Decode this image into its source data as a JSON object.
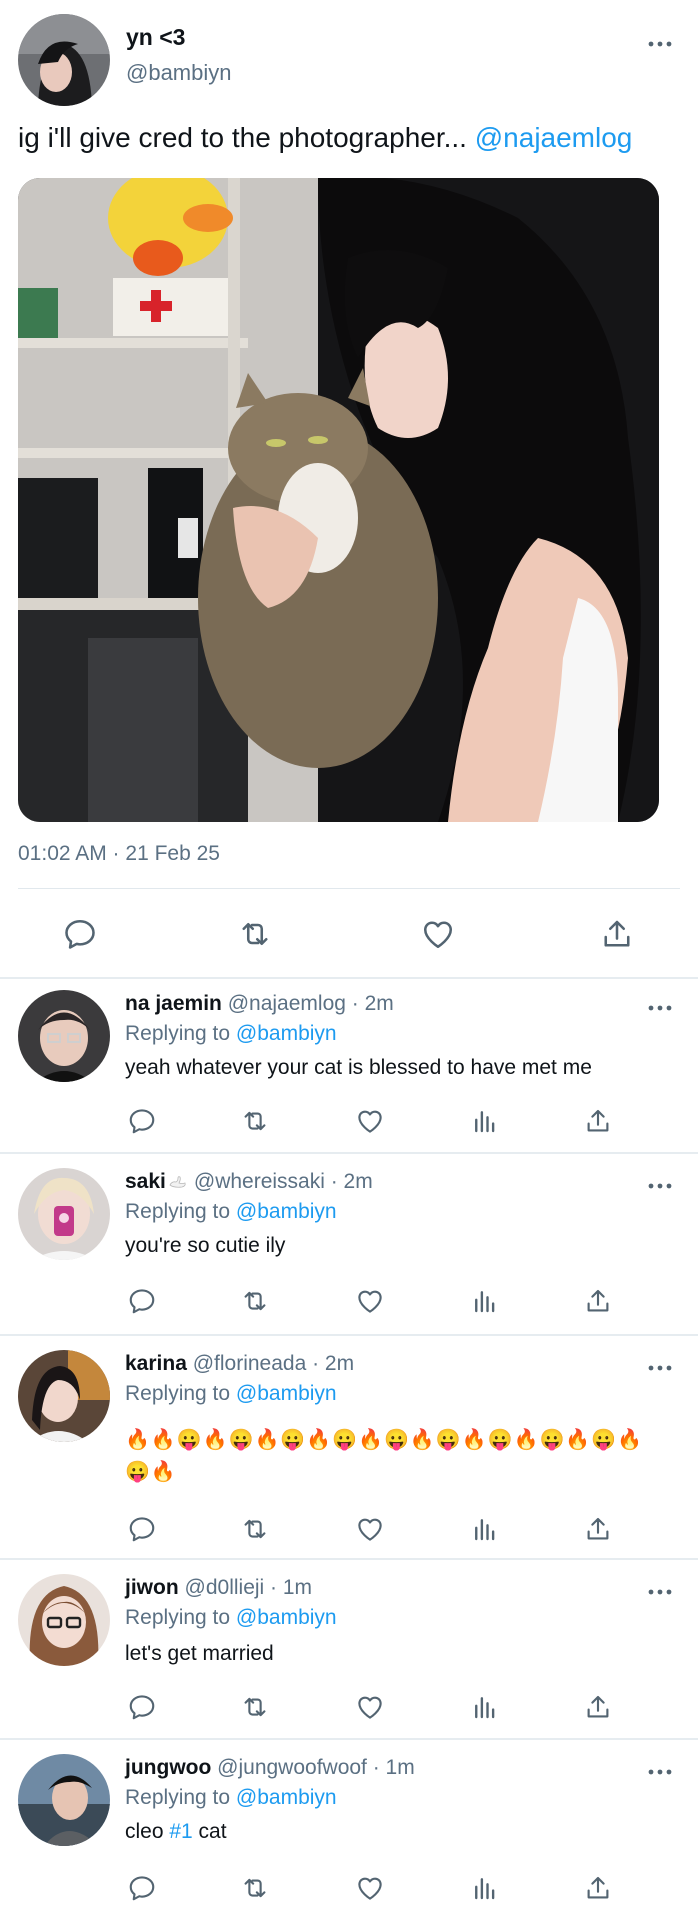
{
  "tweet": {
    "author_name": "yn <3",
    "handle": "@bambiyn",
    "text": "ig i'll give cred to the photographer... ",
    "mention": "@najaemlog",
    "timestamp": "01:02 AM · 21 Feb 25",
    "icons": [
      "reply-icon",
      "retweet-icon",
      "like-icon",
      "share-icon"
    ]
  },
  "replies": [
    {
      "name": "na jaemin",
      "meta": "@najaemlog · 2m",
      "replying_label": "Replying to ",
      "replying_to": "@bambiyn",
      "text": "yeah whatever your cat is blessed to have met me"
    },
    {
      "name": "saki",
      "name_emoji": "swan",
      "meta": "@whereissaki · 2m",
      "replying_label": "Replying to ",
      "replying_to": "@bambiyn",
      "text": "you're so cutie ily"
    },
    {
      "name": "karina",
      "meta": "@florineada · 2m",
      "replying_label": "Replying to ",
      "replying_to": "@bambiyn",
      "text_line1": "🔥🔥😛🔥😛🔥😛🔥😛🔥😛🔥😛🔥😛🔥😛🔥😛🔥",
      "text_line2": "😛🔥"
    },
    {
      "name": "jiwon",
      "meta": "@d0llieji · 1m",
      "replying_label": "Replying to ",
      "replying_to": "@bambiyn",
      "text": "let's get married"
    },
    {
      "name": "jungwoo",
      "meta": "@jungwoofwoof · 1m",
      "replying_label": "Replying to ",
      "replying_to": "@bambiyn",
      "text_prefix": "cleo ",
      "text_tag": "#1",
      "text_suffix": " cat"
    }
  ],
  "reply_action_icons": [
    "reply-icon",
    "retweet-icon",
    "like-icon",
    "views-icon",
    "share-icon"
  ],
  "colors": {
    "link": "#1d9bf0",
    "secondary_text": "#5b7083",
    "icon_gray": "#536471",
    "divider": "#e1e8ed"
  }
}
